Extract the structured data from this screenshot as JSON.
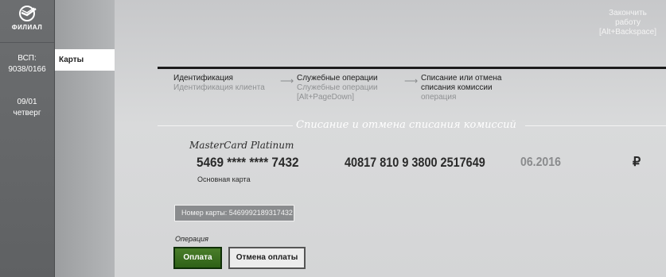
{
  "brand": {
    "logo_text": "ФИЛИАЛ",
    "accent": "#2e6117"
  },
  "sidebar": {
    "vsp_label": "ВСП:",
    "vsp_code": "9038/0166",
    "date": "09/01",
    "weekday": "четверг"
  },
  "nav": {
    "active_item": "Карты"
  },
  "header": {
    "finish_line1": "Закончить",
    "finish_line2": "работу",
    "finish_shortcut": "[Alt+Backspace]"
  },
  "steps": [
    {
      "title": "Идентификация",
      "sub": "Идентификация клиента",
      "sub2": ""
    },
    {
      "title": "Служебные операции",
      "sub": "Служебные операции",
      "sub2": "[Alt+PageDown]"
    },
    {
      "title": "Списание или отмена",
      "title2": "списания комиссии",
      "sub": "операция"
    }
  ],
  "section_title": "Списание и отмена списания комиссий",
  "card": {
    "type": "MasterCard Platinum",
    "number_masked": "5469 **** **** 7432",
    "account": "40817 810 9 3800 2517649",
    "expiry": "06.2016",
    "currency": "₽",
    "label": "Основная карта",
    "full_number_field": "Номер карты: 5469992189317432"
  },
  "operation": {
    "label": "Операция",
    "pay_button": "Оплата",
    "cancel_button": "Отмена оплаты"
  }
}
